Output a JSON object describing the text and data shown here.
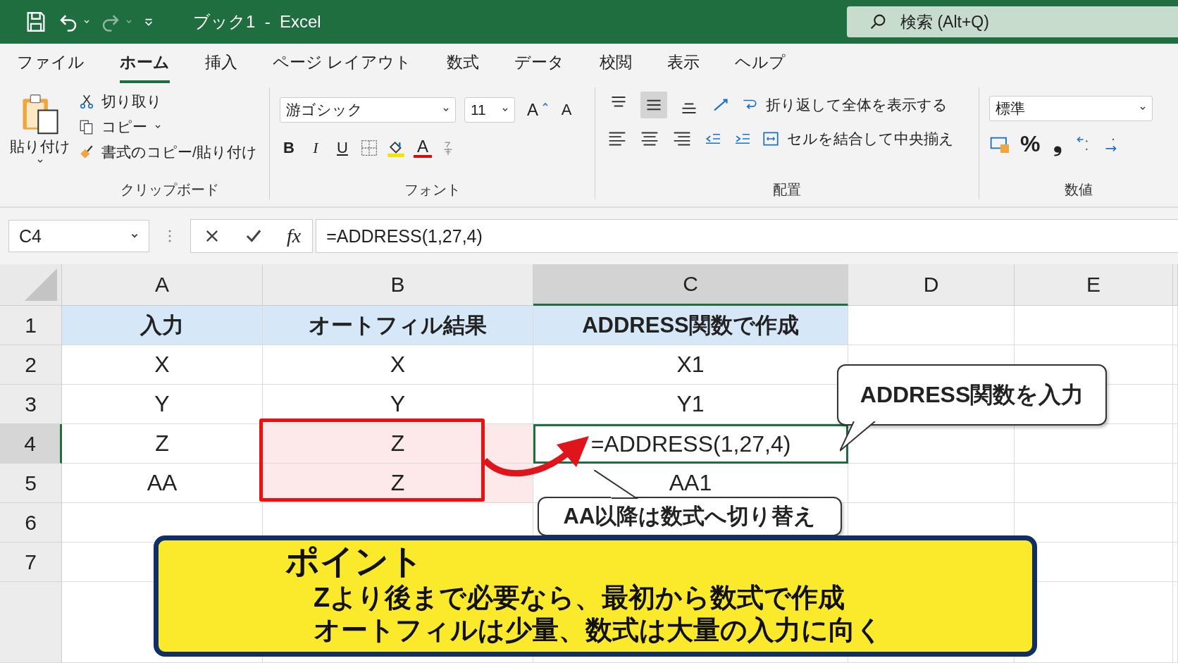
{
  "title_bar": {
    "title": "ブック1  -  Excel",
    "search": {
      "placeholder": "検索 (Alt+Q)"
    }
  },
  "ribbon_tabs": [
    {
      "label": "ファイル",
      "selected": false
    },
    {
      "label": "ホーム",
      "selected": true
    },
    {
      "label": "挿入",
      "selected": false
    },
    {
      "label": "ページ レイアウト",
      "selected": false
    },
    {
      "label": "数式",
      "selected": false
    },
    {
      "label": "データ",
      "selected": false
    },
    {
      "label": "校閲",
      "selected": false
    },
    {
      "label": "表示",
      "selected": false
    },
    {
      "label": "ヘルプ",
      "selected": false
    }
  ],
  "clipboard": {
    "paste": "貼り付け",
    "cut": "切り取り",
    "copy": "コピー",
    "format_painter": "書式のコピー/貼り付け",
    "group_label": "クリップボード"
  },
  "font": {
    "font_name": "游ゴシック",
    "font_size": "11",
    "grow": "A",
    "shrink": "A",
    "bold": "B",
    "italic": "I",
    "underline": "U",
    "font_color": "A",
    "group_label": "フォント"
  },
  "alignment": {
    "vertical": [
      {
        "selected": false
      },
      {
        "selected": true
      },
      {
        "selected": false
      }
    ],
    "wrap_text": "折り返して全体を表示する",
    "merge_center": "セルを結合して中央揃え",
    "group_label": "配置"
  },
  "number": {
    "format": "標準",
    "percent": "%",
    "comma": "❟",
    "group_label": "数値"
  },
  "formula_bar": {
    "name_box": "C4",
    "fx": "fx",
    "formula": "=ADDRESS(1,27,4)"
  },
  "sheet": {
    "columns": [
      {
        "label": "A",
        "selected": false
      },
      {
        "label": "B",
        "selected": false
      },
      {
        "label": "C",
        "selected": true
      },
      {
        "label": "D",
        "selected": false
      },
      {
        "label": "E",
        "selected": false
      }
    ],
    "rows": [
      {
        "header": "1",
        "kind": "heading",
        "selected": false,
        "cells": [
          {
            "text": "入力",
            "highlighted": false
          },
          {
            "text": "オートフィル結果",
            "highlighted": false
          },
          {
            "text": "ADDRESS関数で作成",
            "highlighted": false
          }
        ]
      },
      {
        "header": "2",
        "kind": "data",
        "selected": false,
        "cells": [
          {
            "text": "X",
            "highlighted": false
          },
          {
            "text": "X",
            "highlighted": false
          },
          {
            "text": "X1",
            "highlighted": false
          }
        ]
      },
      {
        "header": "3",
        "kind": "data",
        "selected": false,
        "cells": [
          {
            "text": "Y",
            "highlighted": false
          },
          {
            "text": "Y",
            "highlighted": false
          },
          {
            "text": "Y1",
            "highlighted": false
          }
        ]
      },
      {
        "header": "4",
        "kind": "data",
        "selected": true,
        "cells": [
          {
            "text": "Z",
            "highlighted": false
          },
          {
            "text": "Z",
            "highlighted": true
          },
          {
            "text": "=ADDRESS(1,27,4)",
            "highlighted": false
          }
        ]
      },
      {
        "header": "5",
        "kind": "data",
        "selected": false,
        "cells": [
          {
            "text": "AA",
            "highlighted": false
          },
          {
            "text": "Z",
            "highlighted": true
          },
          {
            "text": "AA1",
            "highlighted": false
          }
        ]
      },
      {
        "header": "6",
        "selected": false,
        "cells": []
      },
      {
        "header": "7",
        "selected": false,
        "cells": []
      }
    ]
  },
  "callouts": [
    {
      "text": "ADDRESS関数を入力"
    },
    {
      "text": "AA以降は数式へ切り替え"
    }
  ],
  "point": {
    "title": "ポイント",
    "lines": [
      "Zより後まで必要なら、最初から数式で作成",
      "オートフィルは少量、数式は大量の入力に向く"
    ]
  }
}
